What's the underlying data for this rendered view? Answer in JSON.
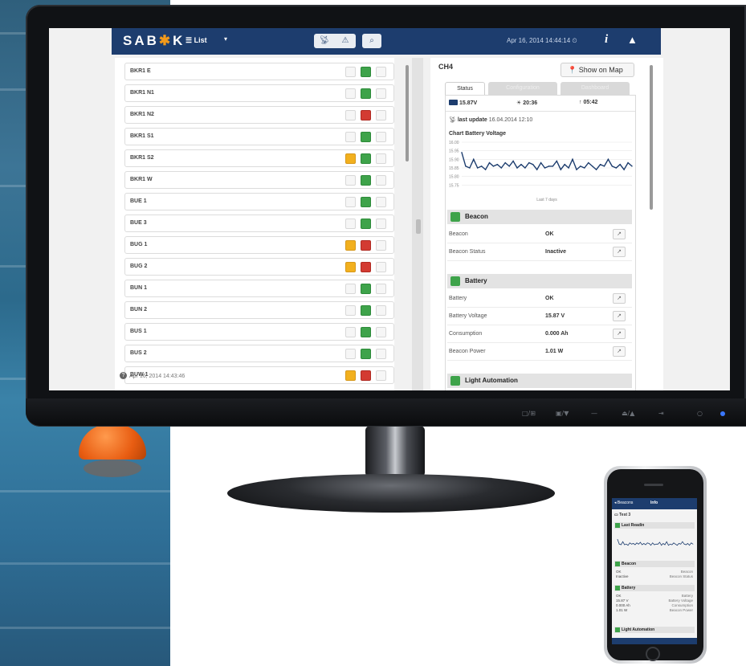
{
  "brand": {
    "logo_prefix": "SAB",
    "logo_star": "✱",
    "logo_suffix": "K",
    "primary_color": "#1d3d6e",
    "accent_color": "#f29a1b"
  },
  "header": {
    "list_label": "☰ List",
    "list_caret": "▾",
    "filter_icons": [
      "signal-icon",
      "warning-icon"
    ],
    "search_icon": "search-icon",
    "datetime": "Apr 16, 2014 14:44:14 ⏲",
    "info_label": "i",
    "user_icon": "user-icon"
  },
  "list": {
    "items": [
      {
        "name": "BKR1 E",
        "states": [
          "off",
          "green",
          "off"
        ]
      },
      {
        "name": "BKR1 N1",
        "states": [
          "off",
          "green",
          "off"
        ]
      },
      {
        "name": "BKR1 N2",
        "states": [
          "off",
          "red",
          "off"
        ]
      },
      {
        "name": "BKR1 S1",
        "states": [
          "off",
          "green",
          "off"
        ]
      },
      {
        "name": "BKR1 S2",
        "states": [
          "yellow",
          "green",
          "off"
        ]
      },
      {
        "name": "BKR1 W",
        "states": [
          "off",
          "green",
          "off"
        ]
      },
      {
        "name": "BUE 1",
        "states": [
          "off",
          "green",
          "off"
        ]
      },
      {
        "name": "BUE 3",
        "states": [
          "off",
          "green",
          "off"
        ]
      },
      {
        "name": "BUG 1",
        "states": [
          "yellow",
          "red",
          "off"
        ]
      },
      {
        "name": "BUG 2",
        "states": [
          "yellow",
          "red",
          "off"
        ]
      },
      {
        "name": "BUN 1",
        "states": [
          "off",
          "green",
          "off"
        ]
      },
      {
        "name": "BUN 2",
        "states": [
          "off",
          "green",
          "off"
        ]
      },
      {
        "name": "BUS 1",
        "states": [
          "off",
          "green",
          "off"
        ]
      },
      {
        "name": "BUS 2",
        "states": [
          "off",
          "green",
          "off"
        ]
      },
      {
        "name": "BUW 1",
        "states": [
          "yellow",
          "red",
          "off"
        ]
      }
    ],
    "footer_status": "Apr 16, 2014 14:43:46",
    "help_label": "?"
  },
  "detail": {
    "title": "CH4",
    "show_on_map": "📍 Show on Map",
    "tabs": [
      "Status",
      "Configuration",
      "Dashboard"
    ],
    "summary": {
      "voltage": "15.87V",
      "time1": "20:36",
      "time2": "05:42"
    },
    "last_update_label": "last update",
    "last_update_value": "16.04.2014 12:10",
    "chart_title": "Chart Battery Voltage",
    "sections": {
      "beacon": "Beacon",
      "battery": "Battery",
      "light_automation": "Light Automation"
    },
    "beacon_props": [
      {
        "name": "Beacon",
        "value": "OK"
      },
      {
        "name": "Beacon Status",
        "value": "Inactive"
      }
    ],
    "battery_props": [
      {
        "name": "Battery",
        "value": "OK"
      },
      {
        "name": "Battery Voltage",
        "value": "15.87 V"
      },
      {
        "name": "Consumption",
        "value": "0.000 Ah"
      },
      {
        "name": "Beacon Power",
        "value": "1.01 W"
      }
    ]
  },
  "chart_data": {
    "type": "line",
    "title": "Chart Battery Voltage",
    "xlabel": "Last 7 days",
    "ylabel": "",
    "ylim": [
      15.7,
      16.0
    ],
    "y_ticks": [
      "16.00",
      "15.95",
      "15.90",
      "15.85",
      "15.80",
      "15.75"
    ],
    "series": [
      {
        "name": "",
        "values": [
          15.94,
          15.86,
          15.85,
          15.9,
          15.85,
          15.86,
          15.84,
          15.88,
          15.86,
          15.87,
          15.85,
          15.88,
          15.86,
          15.89,
          15.85,
          15.87,
          15.85,
          15.88,
          15.87,
          15.84,
          15.88,
          15.85,
          15.86,
          15.86,
          15.89,
          15.84,
          15.87,
          15.85,
          15.9,
          15.84,
          15.86,
          15.85,
          15.88,
          15.86,
          15.84,
          15.87,
          15.86,
          15.9,
          15.86,
          15.85,
          15.87,
          15.84,
          15.88,
          15.86
        ]
      }
    ]
  },
  "monitor": {
    "chin_buttons": [
      "□/⊞",
      "▣/▼",
      "—",
      "⏏/▲",
      "⇥",
      "○"
    ]
  },
  "phone": {
    "back_label": "◂ Beacons",
    "title": "Info",
    "item_title": "▭ Test 3",
    "sections": [
      "Last Readin",
      "Beacon",
      "Battery",
      "Light Automation"
    ],
    "beacon_rows": [
      {
        "l": "OK",
        "r": "Beacon"
      },
      {
        "l": "Inactive",
        "r": "Beacon Status"
      }
    ],
    "battery_rows": [
      {
        "l": "OK",
        "r": "Battery"
      },
      {
        "l": "15.87 V",
        "r": "Battery Voltage"
      },
      {
        "l": "0.000 Ah",
        "r": "Consumption"
      },
      {
        "l": "1.01 W",
        "r": "Beacon Power"
      }
    ]
  }
}
